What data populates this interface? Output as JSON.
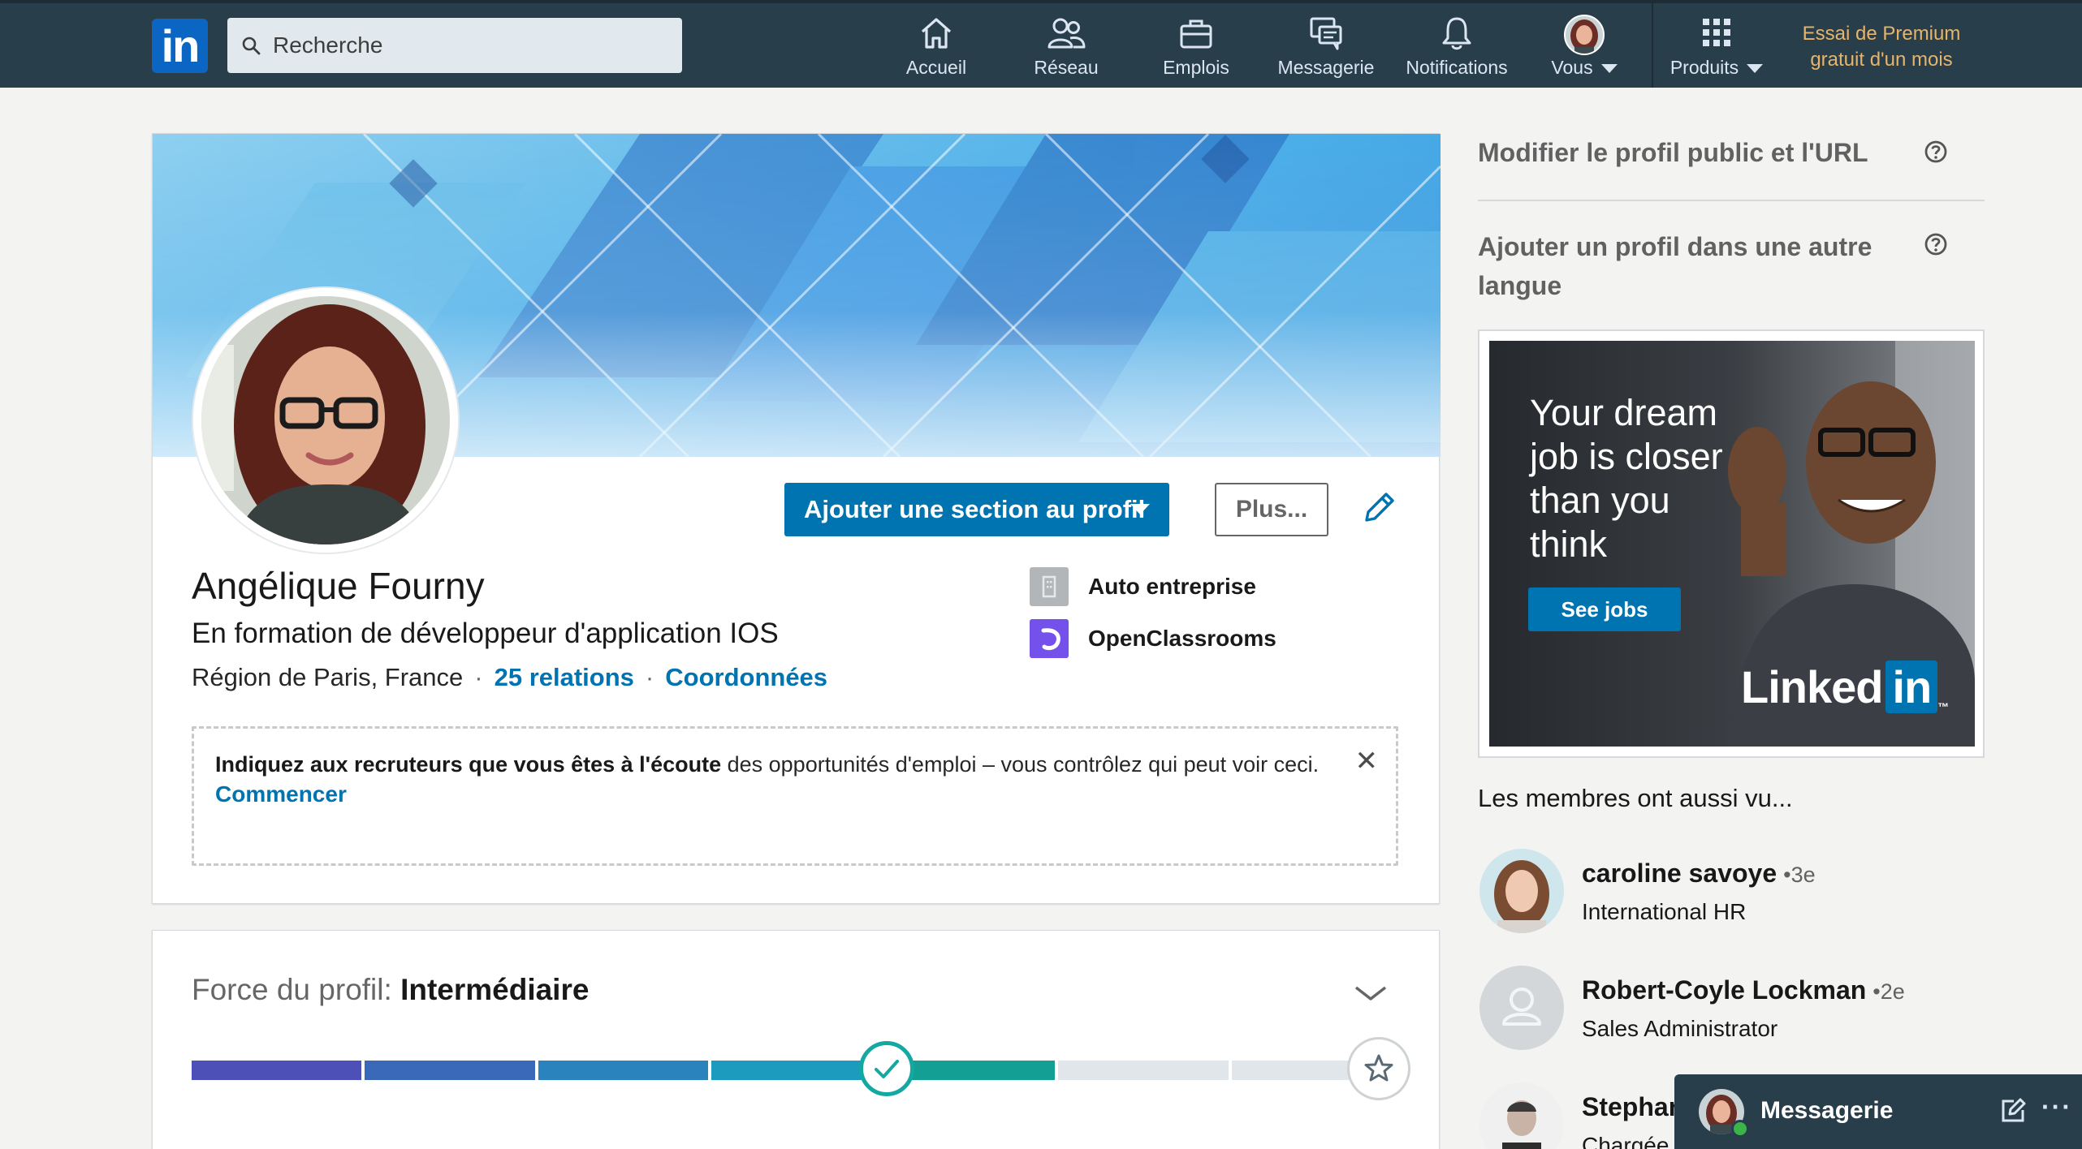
{
  "nav": {
    "logo_text": "in",
    "search_placeholder": "Recherche",
    "items": [
      {
        "label": "Accueil",
        "icon": "home-icon"
      },
      {
        "label": "Réseau",
        "icon": "people-icon"
      },
      {
        "label": "Emplois",
        "icon": "briefcase-icon"
      },
      {
        "label": "Messagerie",
        "icon": "messaging-icon"
      },
      {
        "label": "Notifications",
        "icon": "bell-icon"
      },
      {
        "label": "Vous",
        "icon": "avatar"
      },
      {
        "label": "Produits",
        "icon": "grid-icon"
      }
    ],
    "premium_line1": "Essai de Premium",
    "premium_line2": "gratuit d'un mois"
  },
  "profile": {
    "name": "Angélique Fourny",
    "headline": "En formation de développeur d'application IOS",
    "location": "Région de Paris, France",
    "connections": "25 relations",
    "contact": "Coordonnées",
    "add_section_label": "Ajouter une section au profil",
    "more_label": "Plus...",
    "experiences": [
      {
        "name": "Auto entreprise"
      },
      {
        "name": "OpenClassrooms"
      }
    ],
    "open_to": {
      "bold": "Indiquez aux recruteurs que vous êtes à l'écoute",
      "rest": " des opportunités d'emploi – vous contrôlez qui peut voir ceci.",
      "cta": "Commencer",
      "close": "✕"
    }
  },
  "strength": {
    "prefix": "Force du profil: ",
    "level": "Intermédiaire",
    "level_index": 5,
    "total_levels": 7
  },
  "rail": {
    "edit_public_profile": "Modifier le profil public et l'URL",
    "add_language_profile_line1": "Ajouter un profil dans une autre",
    "add_language_profile_line2": "langue",
    "ad": {
      "line1": "Your dream",
      "line2": "job is closer",
      "line3": "than you",
      "line4": "think",
      "cta": "See jobs",
      "brand": "Linked",
      "brand_in": "in",
      "tm": "™"
    },
    "also_viewed_title": "Les membres ont aussi vu...",
    "people": [
      {
        "name": "caroline savoye",
        "degree": "•3e",
        "role": "International HR"
      },
      {
        "name": "Robert-Coyle Lockman",
        "degree": "•2e",
        "role": "Sales Administrator"
      },
      {
        "name": "Stephar",
        "degree": "",
        "role": "Chargée"
      }
    ]
  },
  "dock": {
    "title": "Messagerie",
    "more": "···"
  },
  "colors": {
    "nav_bg": "#283e4a",
    "primary": "#0073b1",
    "premium_gold": "#e7b46b",
    "meter_filled_end": "#14a8a3"
  }
}
